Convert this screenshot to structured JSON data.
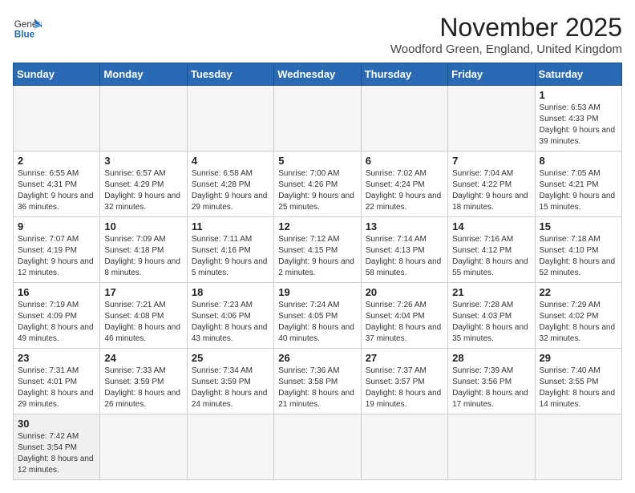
{
  "header": {
    "logo_general": "General",
    "logo_blue": "Blue",
    "month_title": "November 2025",
    "subtitle": "Woodford Green, England, United Kingdom"
  },
  "weekdays": [
    "Sunday",
    "Monday",
    "Tuesday",
    "Wednesday",
    "Thursday",
    "Friday",
    "Saturday"
  ],
  "weeks": [
    [
      {
        "day": "",
        "info": ""
      },
      {
        "day": "",
        "info": ""
      },
      {
        "day": "",
        "info": ""
      },
      {
        "day": "",
        "info": ""
      },
      {
        "day": "",
        "info": ""
      },
      {
        "day": "",
        "info": ""
      },
      {
        "day": "1",
        "info": "Sunrise: 6:53 AM\nSunset: 4:33 PM\nDaylight: 9 hours\nand 39 minutes."
      }
    ],
    [
      {
        "day": "2",
        "info": "Sunrise: 6:55 AM\nSunset: 4:31 PM\nDaylight: 9 hours\nand 36 minutes."
      },
      {
        "day": "3",
        "info": "Sunrise: 6:57 AM\nSunset: 4:29 PM\nDaylight: 9 hours\nand 32 minutes."
      },
      {
        "day": "4",
        "info": "Sunrise: 6:58 AM\nSunset: 4:28 PM\nDaylight: 9 hours\nand 29 minutes."
      },
      {
        "day": "5",
        "info": "Sunrise: 7:00 AM\nSunset: 4:26 PM\nDaylight: 9 hours\nand 25 minutes."
      },
      {
        "day": "6",
        "info": "Sunrise: 7:02 AM\nSunset: 4:24 PM\nDaylight: 9 hours\nand 22 minutes."
      },
      {
        "day": "7",
        "info": "Sunrise: 7:04 AM\nSunset: 4:22 PM\nDaylight: 9 hours\nand 18 minutes."
      },
      {
        "day": "8",
        "info": "Sunrise: 7:05 AM\nSunset: 4:21 PM\nDaylight: 9 hours\nand 15 minutes."
      }
    ],
    [
      {
        "day": "9",
        "info": "Sunrise: 7:07 AM\nSunset: 4:19 PM\nDaylight: 9 hours\nand 12 minutes."
      },
      {
        "day": "10",
        "info": "Sunrise: 7:09 AM\nSunset: 4:18 PM\nDaylight: 9 hours\nand 8 minutes."
      },
      {
        "day": "11",
        "info": "Sunrise: 7:11 AM\nSunset: 4:16 PM\nDaylight: 9 hours\nand 5 minutes."
      },
      {
        "day": "12",
        "info": "Sunrise: 7:12 AM\nSunset: 4:15 PM\nDaylight: 9 hours\nand 2 minutes."
      },
      {
        "day": "13",
        "info": "Sunrise: 7:14 AM\nSunset: 4:13 PM\nDaylight: 8 hours\nand 58 minutes."
      },
      {
        "day": "14",
        "info": "Sunrise: 7:16 AM\nSunset: 4:12 PM\nDaylight: 8 hours\nand 55 minutes."
      },
      {
        "day": "15",
        "info": "Sunrise: 7:18 AM\nSunset: 4:10 PM\nDaylight: 8 hours\nand 52 minutes."
      }
    ],
    [
      {
        "day": "16",
        "info": "Sunrise: 7:19 AM\nSunset: 4:09 PM\nDaylight: 8 hours\nand 49 minutes."
      },
      {
        "day": "17",
        "info": "Sunrise: 7:21 AM\nSunset: 4:08 PM\nDaylight: 8 hours\nand 46 minutes."
      },
      {
        "day": "18",
        "info": "Sunrise: 7:23 AM\nSunset: 4:06 PM\nDaylight: 8 hours\nand 43 minutes."
      },
      {
        "day": "19",
        "info": "Sunrise: 7:24 AM\nSunset: 4:05 PM\nDaylight: 8 hours\nand 40 minutes."
      },
      {
        "day": "20",
        "info": "Sunrise: 7:26 AM\nSunset: 4:04 PM\nDaylight: 8 hours\nand 37 minutes."
      },
      {
        "day": "21",
        "info": "Sunrise: 7:28 AM\nSunset: 4:03 PM\nDaylight: 8 hours\nand 35 minutes."
      },
      {
        "day": "22",
        "info": "Sunrise: 7:29 AM\nSunset: 4:02 PM\nDaylight: 8 hours\nand 32 minutes."
      }
    ],
    [
      {
        "day": "23",
        "info": "Sunrise: 7:31 AM\nSunset: 4:01 PM\nDaylight: 8 hours\nand 29 minutes."
      },
      {
        "day": "24",
        "info": "Sunrise: 7:33 AM\nSunset: 3:59 PM\nDaylight: 8 hours\nand 26 minutes."
      },
      {
        "day": "25",
        "info": "Sunrise: 7:34 AM\nSunset: 3:59 PM\nDaylight: 8 hours\nand 24 minutes."
      },
      {
        "day": "26",
        "info": "Sunrise: 7:36 AM\nSunset: 3:58 PM\nDaylight: 8 hours\nand 21 minutes."
      },
      {
        "day": "27",
        "info": "Sunrise: 7:37 AM\nSunset: 3:57 PM\nDaylight: 8 hours\nand 19 minutes."
      },
      {
        "day": "28",
        "info": "Sunrise: 7:39 AM\nSunset: 3:56 PM\nDaylight: 8 hours\nand 17 minutes."
      },
      {
        "day": "29",
        "info": "Sunrise: 7:40 AM\nSunset: 3:55 PM\nDaylight: 8 hours\nand 14 minutes."
      }
    ],
    [
      {
        "day": "30",
        "info": "Sunrise: 7:42 AM\nSunset: 3:54 PM\nDaylight: 8 hours\nand 12 minutes."
      },
      {
        "day": "",
        "info": ""
      },
      {
        "day": "",
        "info": ""
      },
      {
        "day": "",
        "info": ""
      },
      {
        "day": "",
        "info": ""
      },
      {
        "day": "",
        "info": ""
      },
      {
        "day": "",
        "info": ""
      }
    ]
  ]
}
